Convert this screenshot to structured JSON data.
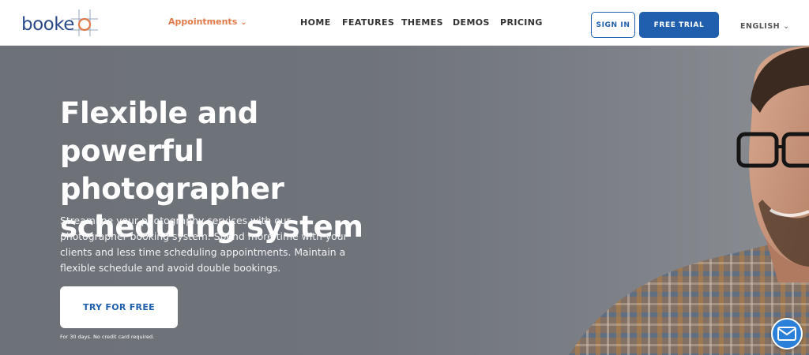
{
  "brand": {
    "logo_text": "booke",
    "primary_color": "#1f5fad",
    "accent_color": "#e07a4a"
  },
  "header": {
    "appointments_label": "Appointments",
    "appointments_caret": "⌄",
    "nav": {
      "home": "HOME",
      "features": "FEATURES",
      "themes": "THEMES",
      "demos": "DEMOS",
      "pricing": "PRICING"
    },
    "sign_in_label": "SIGN IN",
    "free_trial_label": "FREE TRIAL",
    "language_label": "ENGLISH",
    "language_caret": "⌄"
  },
  "hero": {
    "title_lines": [
      "Flexible and powerful",
      "photographer",
      "scheduling system"
    ],
    "description": "Streamline your photography services with our photographer booking system. Spend more time with your clients and less time scheduling appointments. Maintain a flexible schedule and avoid double bookings.",
    "cta_label": "TRY FOR FREE",
    "cta_note": "For 30 days. No credit card required."
  },
  "icons": {
    "chat": "mail-icon",
    "logo_mark": "target-icon"
  }
}
